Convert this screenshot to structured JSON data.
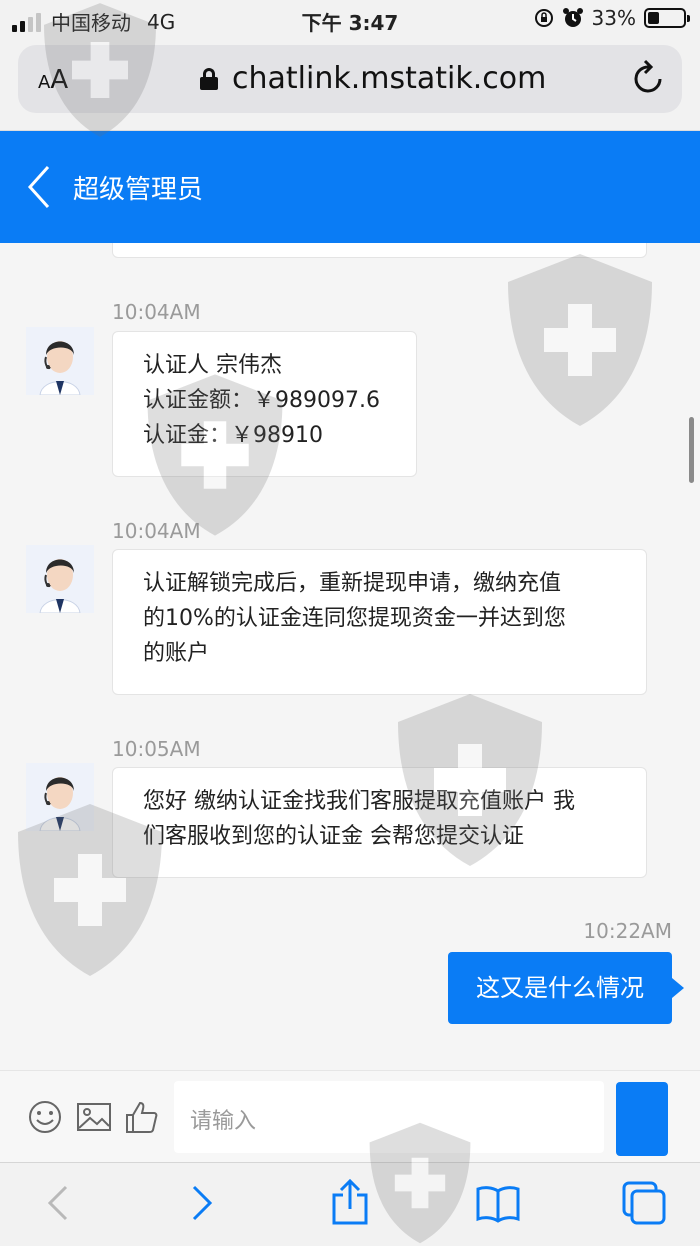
{
  "status_bar": {
    "carrier": "中国移动",
    "network": "4G",
    "time": "下午 3:47",
    "battery": "33%",
    "battery_level": 0.33
  },
  "browser": {
    "text_size_label": "AA",
    "url": "chatlink.mstatik.com"
  },
  "header": {
    "title": "超级管理员"
  },
  "messages": [
    {
      "time": "10:04AM",
      "lines": [
        "认证人 宗伟杰",
        "认证金额：￥989097.6",
        "认证金：￥98910"
      ]
    },
    {
      "time": "10:04AM",
      "lines": [
        "认证解锁完成后，重新提现申请，缴纳充值",
        "的10%的认证金连同您提现资金一并达到您",
        "的账户"
      ]
    },
    {
      "time": "10:05AM",
      "lines": [
        "您好 缴纳认证金找我们客服提取充值账户 我",
        "们客服收到您的认证金 会帮您提交认证"
      ]
    }
  ],
  "my_message": {
    "time": "10:22AM",
    "text": "这又是什么情况"
  },
  "input": {
    "placeholder": "请输入",
    "icons": [
      "emoji-icon",
      "image-icon",
      "thumbs-up-icon"
    ]
  },
  "toolbar_icons": [
    "back-icon",
    "forward-icon",
    "share-icon",
    "bookmarks-icon",
    "tabs-icon"
  ],
  "colors": {
    "accent": "#0a7cf5",
    "background": "#f5f5f5"
  }
}
